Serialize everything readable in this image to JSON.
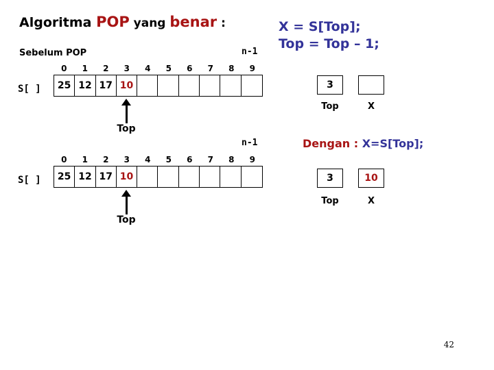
{
  "slide": {
    "page_number": "42",
    "colors": {
      "red": "#a81414",
      "blue": "#333399",
      "black": "#000000",
      "background": "#ffffff"
    }
  },
  "title": {
    "part1": "Algoritma ",
    "keyword1": "POP",
    "part2": " yang ",
    "keyword2": "benar",
    "part3": " :"
  },
  "arrays": [
    {
      "section_label": "Sebelum POP",
      "range_label": "n-1",
      "name_label": "S[ ]",
      "indices": [
        "0",
        "1",
        "2",
        "3",
        "4",
        "5",
        "6",
        "7",
        "8",
        "9"
      ],
      "values": [
        "25",
        "12",
        "17",
        "10",
        "",
        "",
        "",
        "",
        "",
        ""
      ],
      "highlight_index": 3,
      "pointer": {
        "label": "Top",
        "index": 3
      }
    },
    {
      "section_label": "",
      "range_label": "n-1",
      "name_label": "S[ ]",
      "indices": [
        "0",
        "1",
        "2",
        "3",
        "4",
        "5",
        "6",
        "7",
        "8",
        "9"
      ],
      "values": [
        "25",
        "12",
        "17",
        "10",
        "",
        "",
        "",
        "",
        "",
        ""
      ],
      "highlight_index": 3,
      "pointer": {
        "label": "Top",
        "index": 3
      }
    }
  ],
  "code": {
    "line1": "X = S[Top];",
    "line2": "Top = Top – 1;"
  },
  "state_before": {
    "top_value": "3",
    "top_label": "Top",
    "x_value": "",
    "x_label": "X"
  },
  "note": {
    "prefix": "Dengan : ",
    "expression": "X=S[Top];"
  },
  "state_after": {
    "top_value": "3",
    "top_label": "Top",
    "x_value": "10",
    "x_label": "X"
  }
}
